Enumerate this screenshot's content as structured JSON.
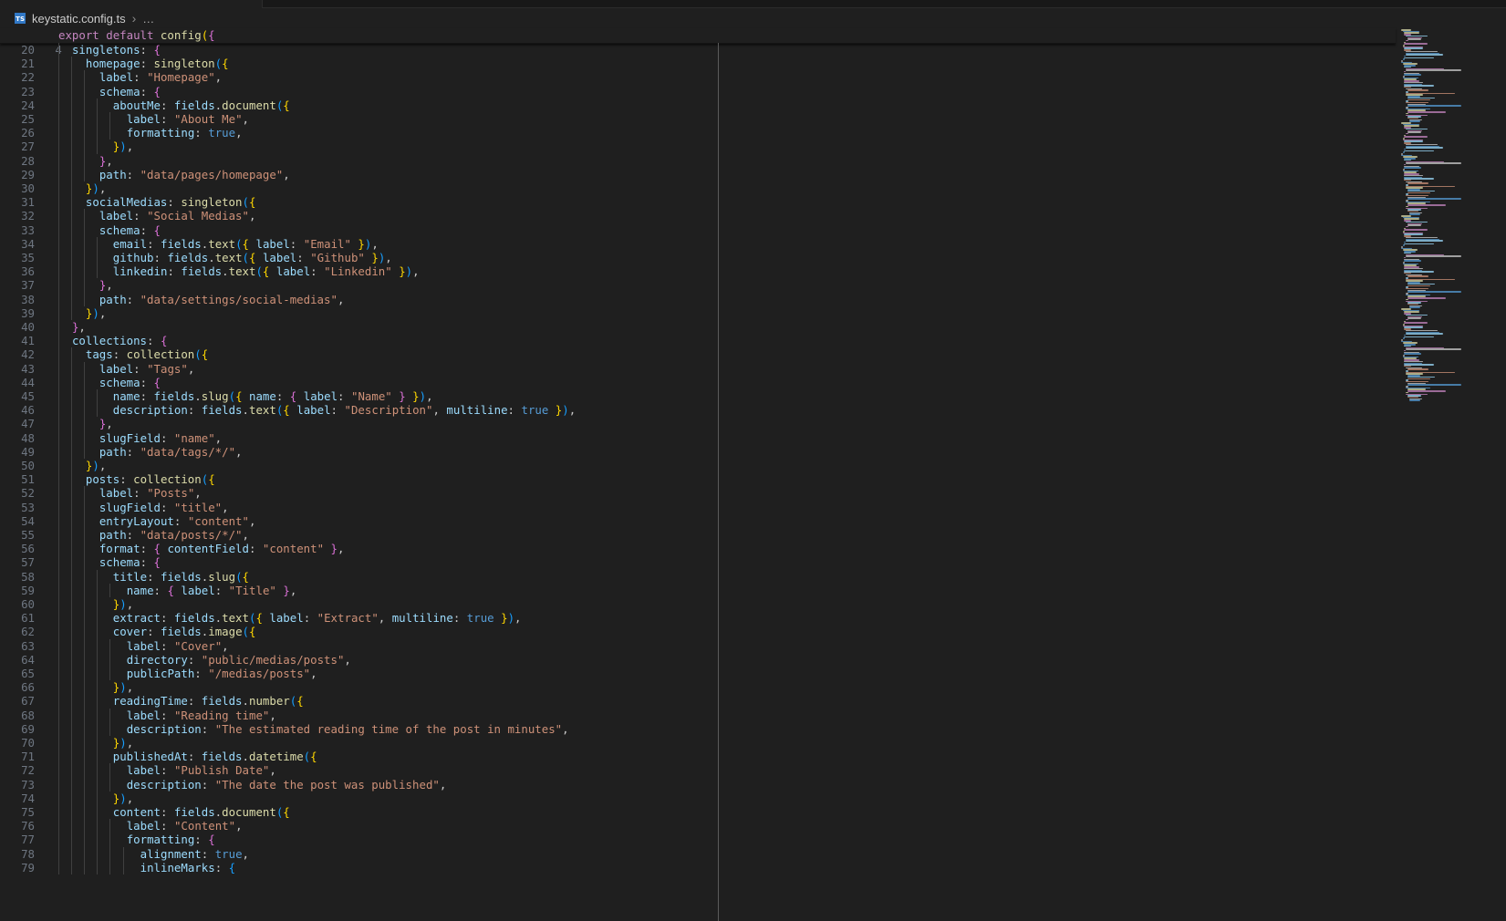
{
  "breadcrumb": {
    "file": "keystatic.config.ts",
    "separator": "›",
    "rest": "…",
    "icon": "typescript-file-icon"
  },
  "sticky": {
    "line_number": "4",
    "text": "export default config({"
  },
  "editor": {
    "lines": [
      {
        "n": "20",
        "text": "  singletons: {"
      },
      {
        "n": "21",
        "text": "    homepage: singleton({"
      },
      {
        "n": "22",
        "text": "      label: \"Homepage\","
      },
      {
        "n": "23",
        "text": "      schema: {"
      },
      {
        "n": "24",
        "text": "        aboutMe: fields.document({"
      },
      {
        "n": "25",
        "text": "          label: \"About Me\","
      },
      {
        "n": "26",
        "text": "          formatting: true,"
      },
      {
        "n": "27",
        "text": "        }),"
      },
      {
        "n": "28",
        "text": "      },"
      },
      {
        "n": "29",
        "text": "      path: \"data/pages/homepage\","
      },
      {
        "n": "30",
        "text": "    }),"
      },
      {
        "n": "31",
        "text": "    socialMedias: singleton({"
      },
      {
        "n": "32",
        "text": "      label: \"Social Medias\","
      },
      {
        "n": "33",
        "text": "      schema: {"
      },
      {
        "n": "34",
        "text": "        email: fields.text({ label: \"Email\" }),"
      },
      {
        "n": "35",
        "text": "        github: fields.text({ label: \"Github\" }),"
      },
      {
        "n": "36",
        "text": "        linkedin: fields.text({ label: \"Linkedin\" }),"
      },
      {
        "n": "37",
        "text": "      },"
      },
      {
        "n": "38",
        "text": "      path: \"data/settings/social-medias\","
      },
      {
        "n": "39",
        "text": "    }),"
      },
      {
        "n": "40",
        "text": "  },"
      },
      {
        "n": "41",
        "text": "  collections: {"
      },
      {
        "n": "42",
        "text": "    tags: collection({"
      },
      {
        "n": "43",
        "text": "      label: \"Tags\","
      },
      {
        "n": "44",
        "text": "      schema: {"
      },
      {
        "n": "45",
        "text": "        name: fields.slug({ name: { label: \"Name\" } }),"
      },
      {
        "n": "46",
        "text": "        description: fields.text({ label: \"Description\", multiline: true }),"
      },
      {
        "n": "47",
        "text": "      },"
      },
      {
        "n": "48",
        "text": "      slugField: \"name\","
      },
      {
        "n": "49",
        "text": "      path: \"data/tags/*/\","
      },
      {
        "n": "50",
        "text": "    }),"
      },
      {
        "n": "51",
        "text": "    posts: collection({"
      },
      {
        "n": "52",
        "text": "      label: \"Posts\","
      },
      {
        "n": "53",
        "text": "      slugField: \"title\","
      },
      {
        "n": "54",
        "text": "      entryLayout: \"content\","
      },
      {
        "n": "55",
        "text": "      path: \"data/posts/*/\","
      },
      {
        "n": "56",
        "text": "      format: { contentField: \"content\" },"
      },
      {
        "n": "57",
        "text": "      schema: {"
      },
      {
        "n": "58",
        "text": "        title: fields.slug({"
      },
      {
        "n": "59",
        "text": "          name: { label: \"Title\" },"
      },
      {
        "n": "60",
        "text": "        }),"
      },
      {
        "n": "61",
        "text": "        extract: fields.text({ label: \"Extract\", multiline: true }),"
      },
      {
        "n": "62",
        "text": "        cover: fields.image({"
      },
      {
        "n": "63",
        "text": "          label: \"Cover\","
      },
      {
        "n": "64",
        "text": "          directory: \"public/medias/posts\","
      },
      {
        "n": "65",
        "text": "          publicPath: \"/medias/posts\","
      },
      {
        "n": "66",
        "text": "        }),"
      },
      {
        "n": "67",
        "text": "        readingTime: fields.number({"
      },
      {
        "n": "68",
        "text": "          label: \"Reading time\","
      },
      {
        "n": "69",
        "text": "          description: \"The estimated reading time of the post in minutes\","
      },
      {
        "n": "70",
        "text": "        }),"
      },
      {
        "n": "71",
        "text": "        publishedAt: fields.datetime({"
      },
      {
        "n": "72",
        "text": "          label: \"Publish Date\","
      },
      {
        "n": "73",
        "text": "          description: \"The date the post was published\","
      },
      {
        "n": "74",
        "text": "        }),"
      },
      {
        "n": "75",
        "text": "        content: fields.document({"
      },
      {
        "n": "76",
        "text": "          label: \"Content\","
      },
      {
        "n": "77",
        "text": "          formatting: {"
      },
      {
        "n": "78",
        "text": "            alignment: true,"
      },
      {
        "n": "79",
        "text": "            inlineMarks: {"
      }
    ]
  },
  "colors": {
    "background": "#1f1f1f",
    "keyword": "#c586c0",
    "function": "#dcdcaa",
    "property": "#9cdcfe",
    "string": "#ce9178",
    "boolean": "#569cd6",
    "bracket_level_1": "#ffd700",
    "bracket_level_2": "#da70d6",
    "bracket_level_3": "#179fff",
    "line_number": "#6e7681"
  }
}
